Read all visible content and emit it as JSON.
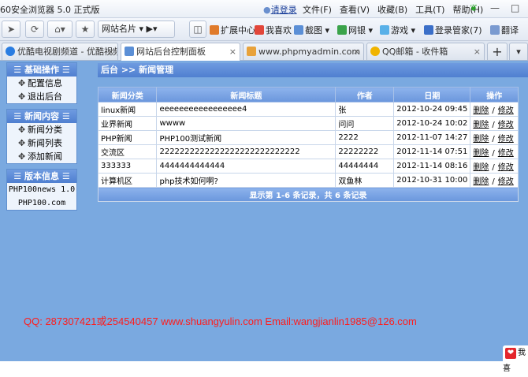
{
  "window": {
    "title": "60安全浏览器 5.0 正式版",
    "login_link": "请登录",
    "menus": [
      "文件(F)",
      "查看(V)",
      "收藏(B)",
      "工具(T)",
      "帮助(H)"
    ]
  },
  "toolbar": {
    "site_label": "网站名片",
    "extensions": "扩展中心",
    "favorites": "我喜欢",
    "screenshot": "截图",
    "bank": "网银",
    "games": "游戏",
    "login_manager": "登录管家(7)",
    "translate": "翻译"
  },
  "tabs": [
    {
      "label": "优酷电视剧频道 - 优酷视频",
      "color": "#2a7de1"
    },
    {
      "label": "网站后台控制面板",
      "color": "#5b8fd6"
    },
    {
      "label": "www.phpmyadmin.com ...",
      "color": "#e8a23b"
    },
    {
      "label": "QQ邮箱 - 收件箱",
      "color": "#f0b400"
    }
  ],
  "sidebar": {
    "sections": [
      {
        "title": "基础操作",
        "items": [
          "配置信息",
          "退出后台"
        ]
      },
      {
        "title": "新闻内容",
        "items": [
          "新闻分类",
          "新闻列表",
          "添加新闻"
        ]
      }
    ],
    "version": {
      "title": "版本信息",
      "lines": [
        "PHP100news 1.0",
        "PHP100.com"
      ]
    }
  },
  "main": {
    "breadcrumb": "后台 >> 新闻管理",
    "columns": [
      "新闻分类",
      "新闻标题",
      "作者",
      "日期",
      "操作"
    ],
    "rows": [
      {
        "category": "linux新闻",
        "title": "eeeeeeeeeeeeeeeee4",
        "author": "张",
        "date": "2012-10-24 09:45"
      },
      {
        "category": "业界新闻",
        "title": "wwww",
        "author": "问问",
        "date": "2012-10-24 10:02"
      },
      {
        "category": "PHP新闻",
        "title": "PHP100测试新闻",
        "author": "2222",
        "date": "2012-11-07 14:27"
      },
      {
        "category": "交流区",
        "title": "2222222222222222222222222222",
        "author": "22222222",
        "date": "2012-11-14 07:51"
      },
      {
        "category": "333333",
        "title": "4444444444444",
        "author": "44444444",
        "date": "2012-11-14 08:16"
      },
      {
        "category": "计算机区",
        "title": "php技术如何啊?",
        "author": "双鱼林",
        "date": "2012-10-31 10:00"
      }
    ],
    "op_delete": "删除",
    "op_sep": "/",
    "op_edit": "修改",
    "footer": "显示第 1-6 条记录，共 6 条记录"
  },
  "watermark": "QQ: 287307421或254540457 www.shuangyulin.com Email:wangjianlin1985@126.com",
  "corner_label": "我喜",
  "colors": {
    "page_bg": "#7aa9e0",
    "header_blue": "#5b88d6",
    "watermark": "#ff1c1c"
  }
}
